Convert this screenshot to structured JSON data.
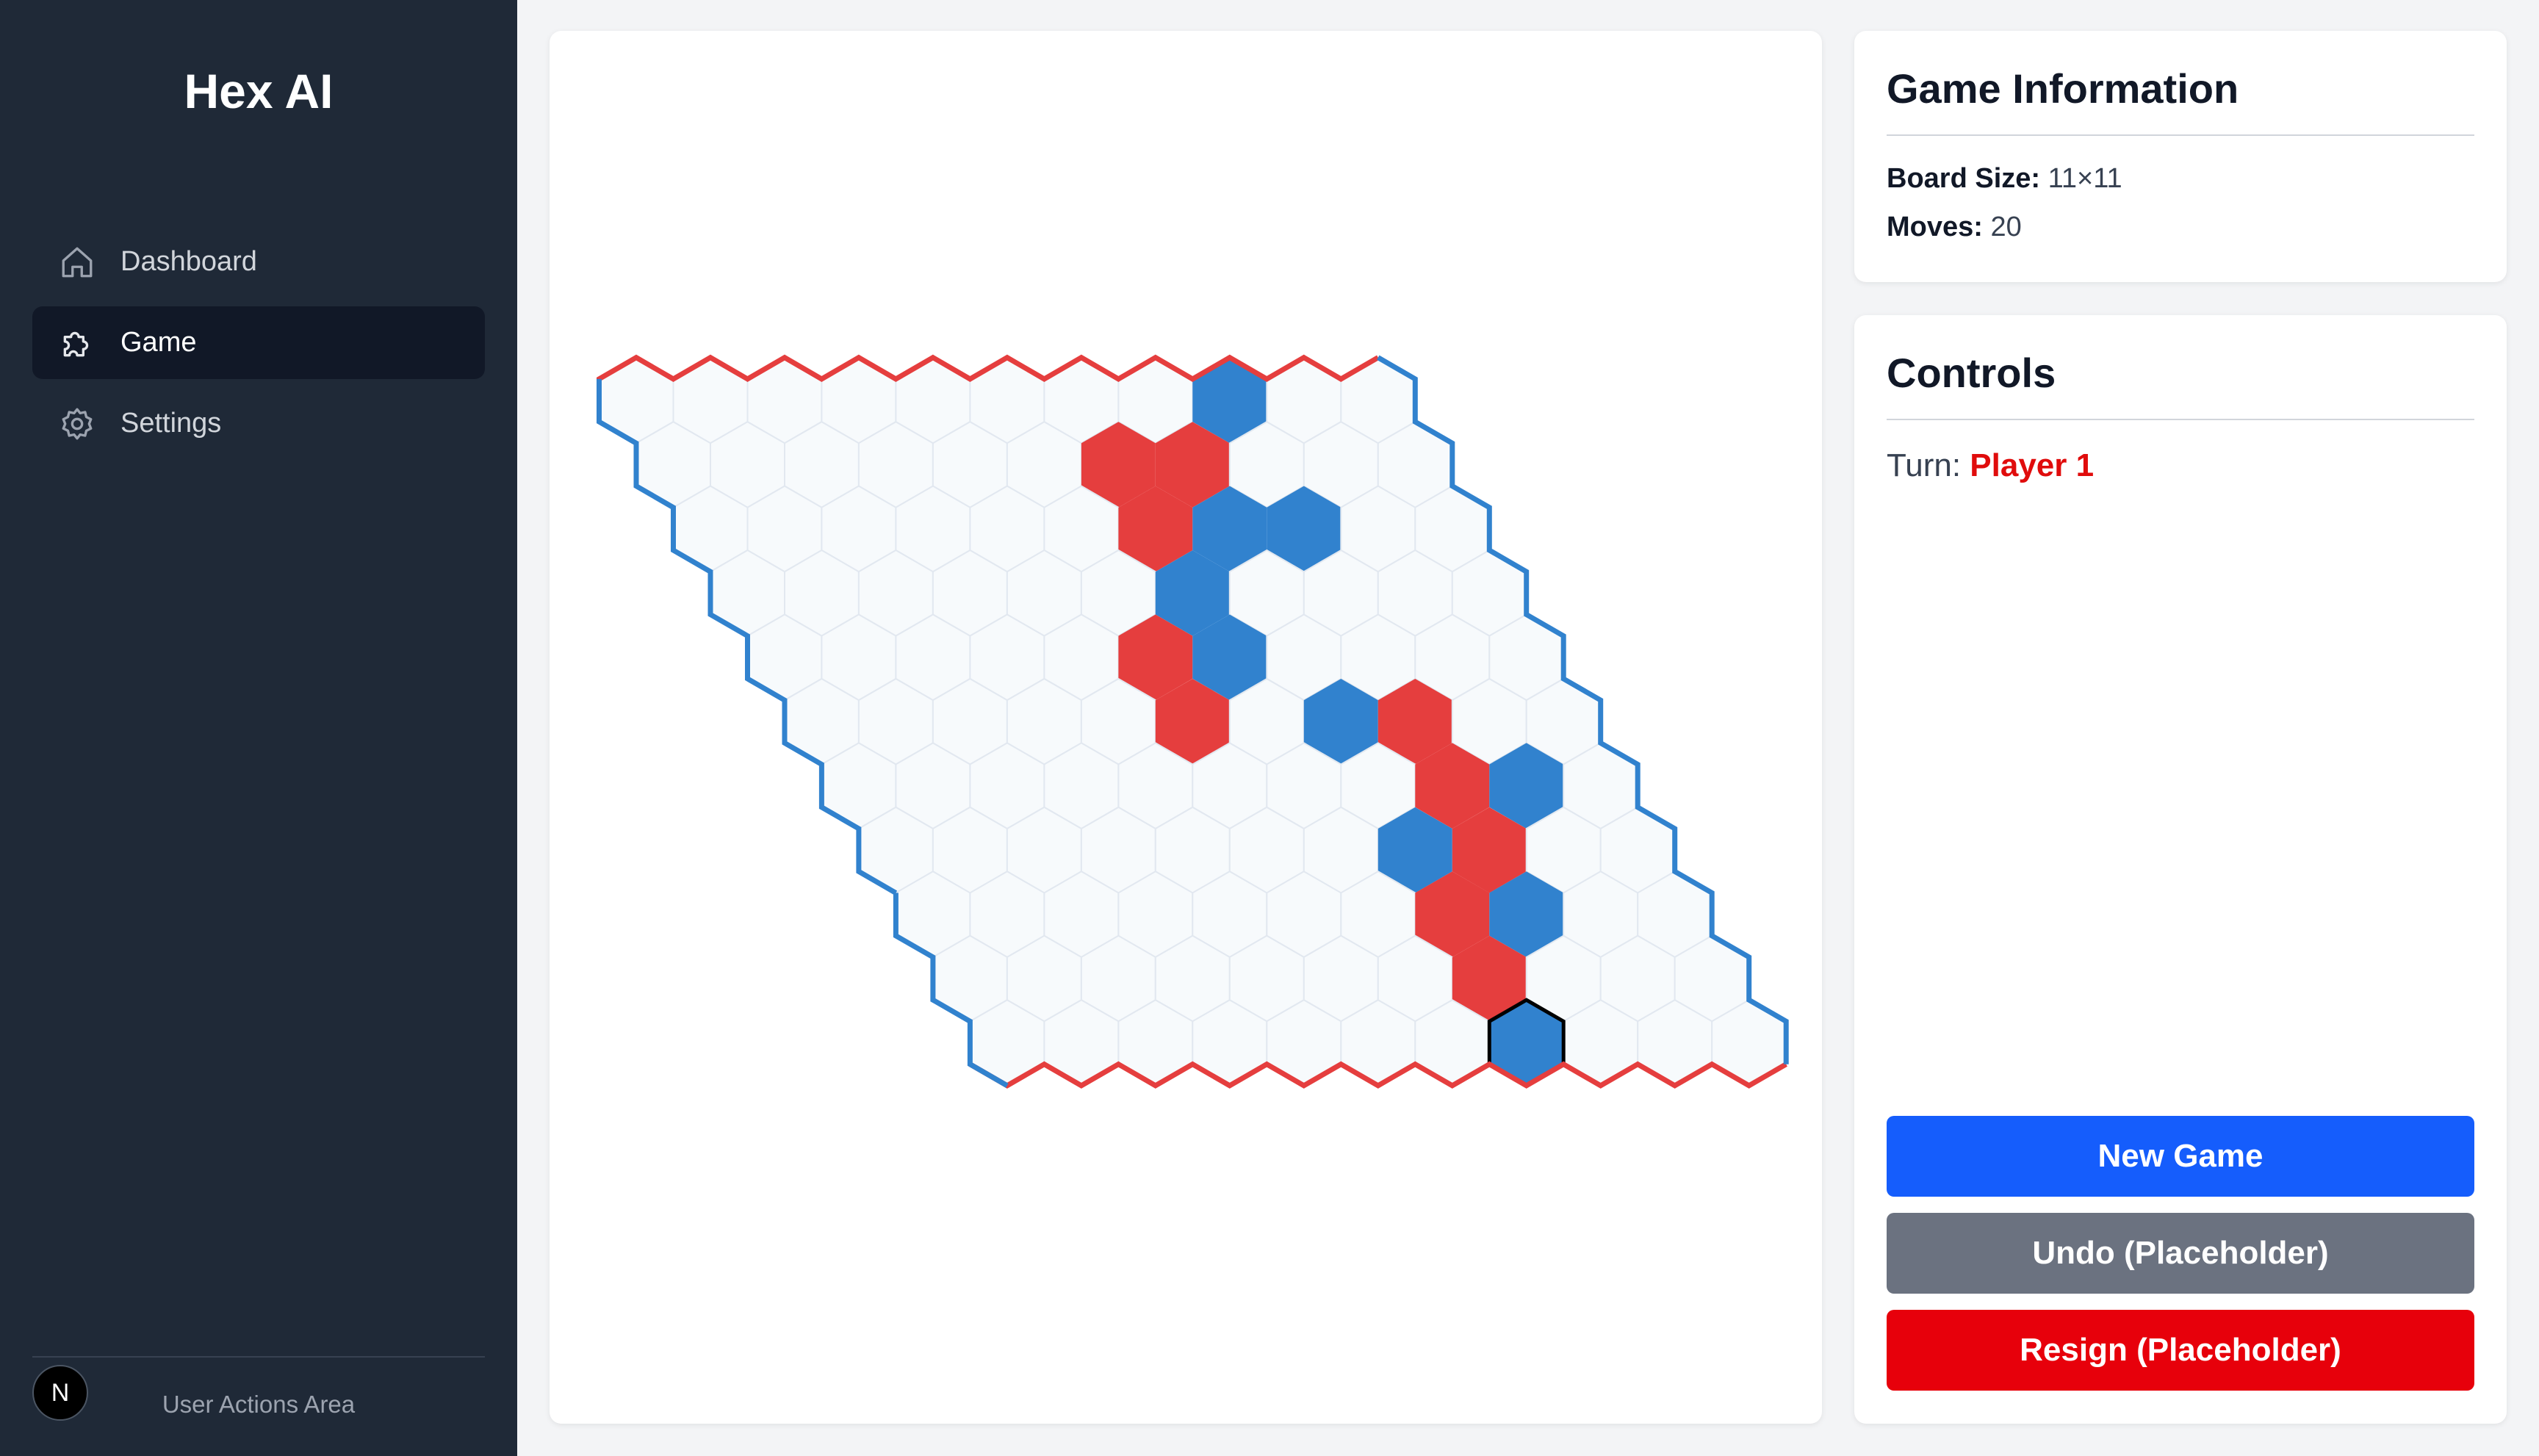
{
  "app": {
    "title": "Hex AI"
  },
  "sidebar": {
    "items": [
      {
        "label": "Dashboard",
        "icon": "home-icon",
        "active": false
      },
      {
        "label": "Game",
        "icon": "puzzle-icon",
        "active": true
      },
      {
        "label": "Settings",
        "icon": "gear-icon",
        "active": false
      }
    ],
    "avatar_letter": "N",
    "user_actions": "User Actions Area"
  },
  "game_info": {
    "heading": "Game Information",
    "board_size_label": "Board Size:",
    "board_size_value": "11×11",
    "moves_label": "Moves:",
    "moves_value": "20"
  },
  "controls": {
    "heading": "Controls",
    "turn_label": "Turn:",
    "turn_player": "Player 1",
    "new_game": "New Game",
    "undo": "Undo (Placeholder)",
    "resign": "Resign (Placeholder)"
  },
  "board": {
    "size": 11,
    "colors": {
      "player1": "#e53e3e",
      "player2": "#3182ce",
      "empty": "#f7fafc",
      "cell_border": "#e2e8f0",
      "last_move_outline": "#000000"
    },
    "red_stones": [
      [
        1,
        6
      ],
      [
        1,
        7
      ],
      [
        2,
        6
      ],
      [
        4,
        5
      ],
      [
        5,
        5
      ],
      [
        5,
        8
      ],
      [
        6,
        8
      ],
      [
        7,
        8
      ],
      [
        8,
        7
      ],
      [
        9,
        7
      ]
    ],
    "blue_stones": [
      [
        0,
        8
      ],
      [
        2,
        7
      ],
      [
        2,
        8
      ],
      [
        3,
        6
      ],
      [
        4,
        6
      ],
      [
        5,
        7
      ],
      [
        6,
        9
      ],
      [
        7,
        7
      ],
      [
        8,
        8
      ],
      [
        10,
        7
      ]
    ],
    "last_move": [
      10,
      7
    ]
  }
}
